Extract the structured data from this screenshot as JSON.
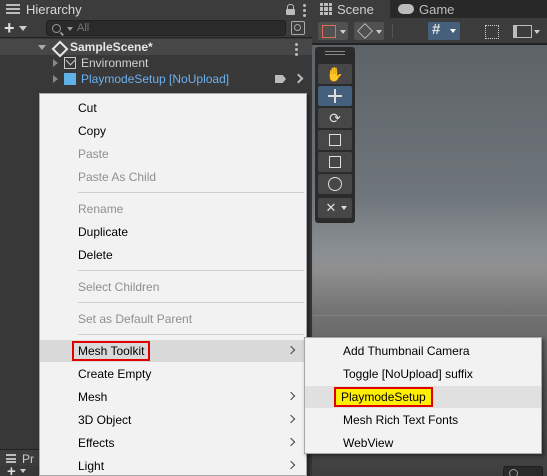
{
  "hierarchy": {
    "tab_title": "Hierarchy",
    "search_placeholder": "All",
    "scene_name": "SampleScene*",
    "items": [
      {
        "label": "Environment"
      },
      {
        "label": "PlaymodeSetup [NoUpload]"
      }
    ],
    "project_tab_fragment": "Pr"
  },
  "scene_view": {
    "tabs": [
      {
        "label": "Scene"
      },
      {
        "label": "Game"
      }
    ]
  },
  "context_menu": {
    "items": [
      {
        "label": "Cut",
        "enabled": true
      },
      {
        "label": "Copy",
        "enabled": true
      },
      {
        "label": "Paste",
        "enabled": false
      },
      {
        "label": "Paste As Child",
        "enabled": false
      },
      {
        "label": "Rename",
        "enabled": false
      },
      {
        "label": "Duplicate",
        "enabled": true
      },
      {
        "label": "Delete",
        "enabled": true
      },
      {
        "label": "Select Children",
        "enabled": false
      },
      {
        "label": "Set as Default Parent",
        "enabled": false
      },
      {
        "label": "Mesh Toolkit",
        "enabled": true,
        "submenu": true,
        "highlighted": true
      },
      {
        "label": "Create Empty",
        "enabled": true
      },
      {
        "label": "Mesh",
        "enabled": true,
        "submenu": true
      },
      {
        "label": "3D Object",
        "enabled": true,
        "submenu": true
      },
      {
        "label": "Effects",
        "enabled": true,
        "submenu": true
      },
      {
        "label": "Light",
        "enabled": true,
        "submenu": true
      }
    ]
  },
  "submenu": {
    "items": [
      {
        "label": "Add Thumbnail Camera"
      },
      {
        "label": "Toggle [NoUpload] suffix"
      },
      {
        "label": "PlaymodeSetup",
        "highlighted": true
      },
      {
        "label": "Mesh Rich Text Fonts"
      },
      {
        "label": "WebView"
      }
    ]
  },
  "colors": {
    "prefab_text": "#6cb1ef",
    "annotation_red": "#e00000",
    "annotation_yellow": "#ffef00"
  }
}
